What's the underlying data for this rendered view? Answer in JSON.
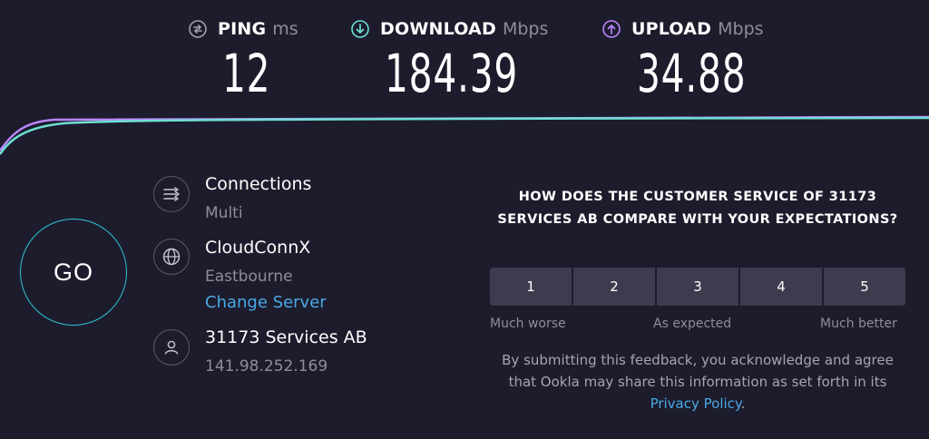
{
  "metrics": {
    "ping": {
      "label": "PING",
      "unit": "ms",
      "value": "12",
      "icon": "ping-icon",
      "color": "#a0a0b0"
    },
    "download": {
      "label": "DOWNLOAD",
      "unit": "Mbps",
      "value": "184.39",
      "icon": "download-arrow-icon",
      "color": "#6ee0d2"
    },
    "upload": {
      "label": "UPLOAD",
      "unit": "Mbps",
      "value": "34.88",
      "icon": "upload-arrow-icon",
      "color": "#bb86fc"
    }
  },
  "go_button": {
    "label": "GO",
    "color": "#2fc4d2"
  },
  "connections": {
    "title": "Connections",
    "value": "Multi",
    "icon": "connections-icon"
  },
  "server": {
    "name": "CloudConnX",
    "location": "Eastbourne",
    "change_label": "Change Server",
    "icon": "globe-icon"
  },
  "provider": {
    "name": "31173 Services AB",
    "ip": "141.98.252.169",
    "icon": "user-icon"
  },
  "survey": {
    "question": "HOW DOES THE CUSTOMER SERVICE OF 31173 SERVICES AB COMPARE WITH YOUR EXPECTATIONS?",
    "options": [
      "1",
      "2",
      "3",
      "4",
      "5"
    ],
    "scale_labels": {
      "low": "Much worse",
      "mid": "As expected",
      "high": "Much better"
    },
    "disclaimer_text": "By submitting this feedback, you acknowledge and agree that Ookla may share this information as set forth in its",
    "privacy_link": "Privacy Policy",
    "disclaimer_end": "."
  },
  "colors": {
    "background": "#1c1c2c",
    "accent_link": "#4aa8e6",
    "download_line": "#6ee0d2",
    "upload_line": "#bb86fc"
  }
}
